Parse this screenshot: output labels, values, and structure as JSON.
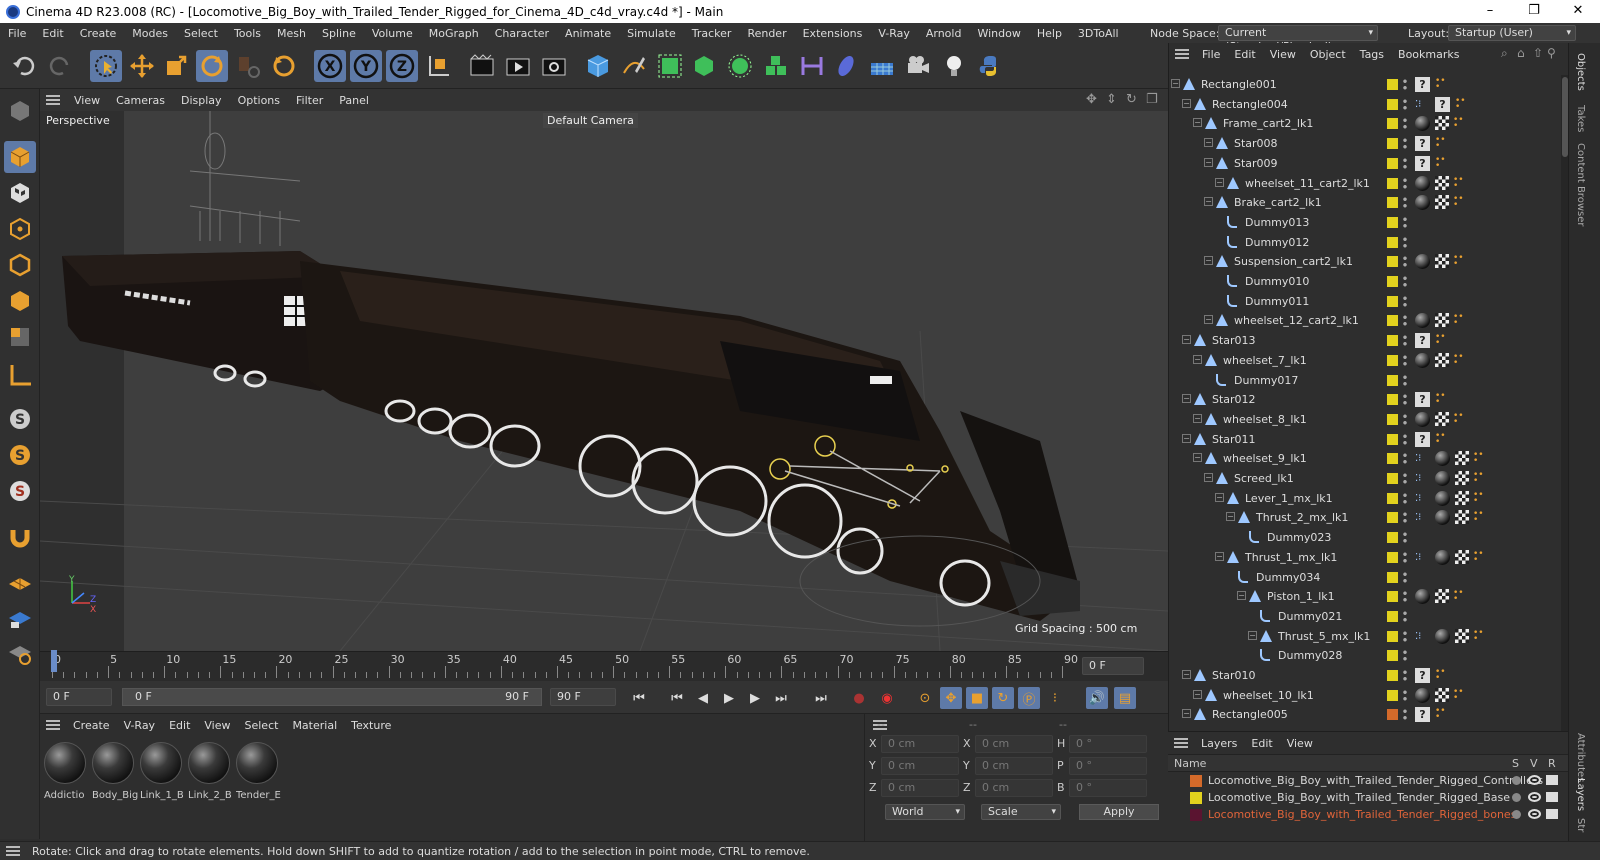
{
  "window": {
    "title": "Cinema 4D R23.008 (RC) - [Locomotive_Big_Boy_with_Trailed_Tender_Rigged_for_Cinema_4D_c4d_vray.c4d *] - Main",
    "minimize": "–",
    "maximize": "❐",
    "close": "✕"
  },
  "menubar": {
    "items": [
      "File",
      "Edit",
      "Create",
      "Modes",
      "Select",
      "Tools",
      "Mesh",
      "Spline",
      "Volume",
      "MoGraph",
      "Character",
      "Animate",
      "Simulate",
      "Tracker",
      "Render",
      "Extensions",
      "V-Ray",
      "Arnold",
      "Window",
      "Help",
      "3DToAll"
    ],
    "node_space_label": "Node Space:",
    "node_space_value": "Current (Standard/Physical)",
    "layout_label": "Layout:",
    "layout_value": "Startup (User)"
  },
  "viewport": {
    "menu": [
      "View",
      "Cameras",
      "Display",
      "Options",
      "Filter",
      "Panel"
    ],
    "projection": "Perspective",
    "camera": "Default Camera",
    "grid_spacing": "Grid Spacing : 500 cm",
    "axis_x": "X",
    "axis_y": "Y",
    "axis_z": "Z"
  },
  "timeline": {
    "ticks": [
      "0",
      "5",
      "10",
      "15",
      "20",
      "25",
      "30",
      "35",
      "40",
      "45",
      "50",
      "55",
      "60",
      "65",
      "70",
      "75",
      "80",
      "85",
      "90"
    ],
    "current_frame_field": "0 F"
  },
  "transport": {
    "start_field": "0 F",
    "range_start": "0 F",
    "range_end": "90 F",
    "end_field": "90 F"
  },
  "material_manager": {
    "menu": [
      "Create",
      "V-Ray",
      "Edit",
      "View",
      "Select",
      "Material",
      "Texture"
    ],
    "materials": [
      "Addictio",
      "Body_Big",
      "Link_1_B",
      "Link_2_B",
      "Tender_E"
    ]
  },
  "coordinates": {
    "header": [
      "--",
      "--",
      "--"
    ],
    "rows": [
      {
        "l1": "X",
        "v1": "0 cm",
        "l2": "X",
        "v2": "0 cm",
        "l3": "H",
        "v3": "0 °"
      },
      {
        "l1": "Y",
        "v1": "0 cm",
        "l2": "Y",
        "v2": "0 cm",
        "l3": "P",
        "v3": "0 °"
      },
      {
        "l1": "Z",
        "v1": "0 cm",
        "l2": "Z",
        "v2": "0 cm",
        "l3": "B",
        "v3": "0 °"
      }
    ],
    "world": "World",
    "scale": "Scale",
    "apply": "Apply"
  },
  "object_manager": {
    "menu": [
      "File",
      "Edit",
      "View",
      "Object",
      "Tags",
      "Bookmarks"
    ],
    "objects": [
      {
        "name": "Rectangle001",
        "depth": 0,
        "type": "bone",
        "tags": "q"
      },
      {
        "name": "Rectangle004",
        "depth": 1,
        "type": "bone",
        "tags": "aq"
      },
      {
        "name": "Frame_cart2_lk1",
        "depth": 2,
        "type": "bone",
        "tags": "mc"
      },
      {
        "name": "Star008",
        "depth": 3,
        "type": "bone",
        "tags": "q"
      },
      {
        "name": "Star009",
        "depth": 3,
        "type": "bone",
        "tags": "q"
      },
      {
        "name": "wheelset_11_cart2_lk1",
        "depth": 4,
        "type": "bone",
        "tags": "mc"
      },
      {
        "name": "Brake_cart2_lk1",
        "depth": 3,
        "type": "bone",
        "tags": "mc"
      },
      {
        "name": "Dummy013",
        "depth": 4,
        "type": "null",
        "tags": ""
      },
      {
        "name": "Dummy012",
        "depth": 4,
        "type": "null",
        "tags": ""
      },
      {
        "name": "Suspension_cart2_lk1",
        "depth": 3,
        "type": "bone",
        "tags": "mc"
      },
      {
        "name": "Dummy010",
        "depth": 4,
        "type": "null",
        "tags": ""
      },
      {
        "name": "Dummy011",
        "depth": 4,
        "type": "null",
        "tags": ""
      },
      {
        "name": "wheelset_12_cart2_lk1",
        "depth": 3,
        "type": "bone",
        "tags": "mc"
      },
      {
        "name": "Star013",
        "depth": 1,
        "type": "bone",
        "tags": "q"
      },
      {
        "name": "wheelset_7_lk1",
        "depth": 2,
        "type": "bone",
        "tags": "mc"
      },
      {
        "name": "Dummy017",
        "depth": 3,
        "type": "null",
        "tags": ""
      },
      {
        "name": "Star012",
        "depth": 1,
        "type": "bone",
        "tags": "q"
      },
      {
        "name": "wheelset_8_lk1",
        "depth": 2,
        "type": "bone",
        "tags": "mc"
      },
      {
        "name": "Star011",
        "depth": 1,
        "type": "bone",
        "tags": "q"
      },
      {
        "name": "wheelset_9_lk1",
        "depth": 2,
        "type": "bone",
        "tags": "amc"
      },
      {
        "name": "Screed_lk1",
        "depth": 3,
        "type": "bone",
        "tags": "amc"
      },
      {
        "name": "Lever_1_mx_lk1",
        "depth": 4,
        "type": "bone",
        "tags": "amc"
      },
      {
        "name": "Thrust_2_mx_lk1",
        "depth": 5,
        "type": "bone",
        "tags": "amc"
      },
      {
        "name": "Dummy023",
        "depth": 6,
        "type": "null",
        "tags": ""
      },
      {
        "name": "Thrust_1_mx_lk1",
        "depth": 4,
        "type": "bone",
        "tags": "amc"
      },
      {
        "name": "Dummy034",
        "depth": 5,
        "type": "null",
        "tags": ""
      },
      {
        "name": "Piston_1_lk1",
        "depth": 6,
        "type": "bone",
        "tags": "mc"
      },
      {
        "name": "Dummy021",
        "depth": 7,
        "type": "null",
        "tags": ""
      },
      {
        "name": "Thrust_5_mx_lk1",
        "depth": 7,
        "type": "bone",
        "tags": "amc"
      },
      {
        "name": "Dummy028",
        "depth": 7,
        "type": "null",
        "tags": ""
      },
      {
        "name": "Star010",
        "depth": 1,
        "type": "bone",
        "tags": "q"
      },
      {
        "name": "wheelset_10_lk1",
        "depth": 2,
        "type": "bone",
        "tags": "mc"
      },
      {
        "name": "Rectangle005",
        "depth": 1,
        "type": "bone",
        "tags": "q"
      }
    ]
  },
  "layers_panel": {
    "menu": [
      "Layers",
      "Edit",
      "View"
    ],
    "col_name": "Name",
    "col_s": "S",
    "col_v": "V",
    "col_r": "R",
    "items": [
      {
        "name": "Locomotive_Big_Boy_with_Trailed_Tender_Rigged_Controllers",
        "color": "#d46a2a",
        "text_color": "#d8d8d8"
      },
      {
        "name": "Locomotive_Big_Boy_with_Trailed_Tender_Rigged_Base",
        "color": "#e2d21e",
        "text_color": "#d8d8d8"
      },
      {
        "name": "Locomotive_Big_Boy_with_Trailed_Tender_Rigged_bones",
        "color": "#5a1430",
        "text_color": "#e0643a"
      }
    ]
  },
  "right_tabs": [
    "Objects",
    "Takes",
    "Content Browser",
    "Attributes",
    "Layers",
    "Str"
  ],
  "status": "Rotate: Click and drag to rotate elements. Hold down SHIFT to add to quantize rotation / add to the selection in point mode, CTRL to remove.",
  "colors": {
    "accent": "#5e7aa8",
    "object_dot": "#e2d21e",
    "playhead": "#6a8cc8"
  }
}
